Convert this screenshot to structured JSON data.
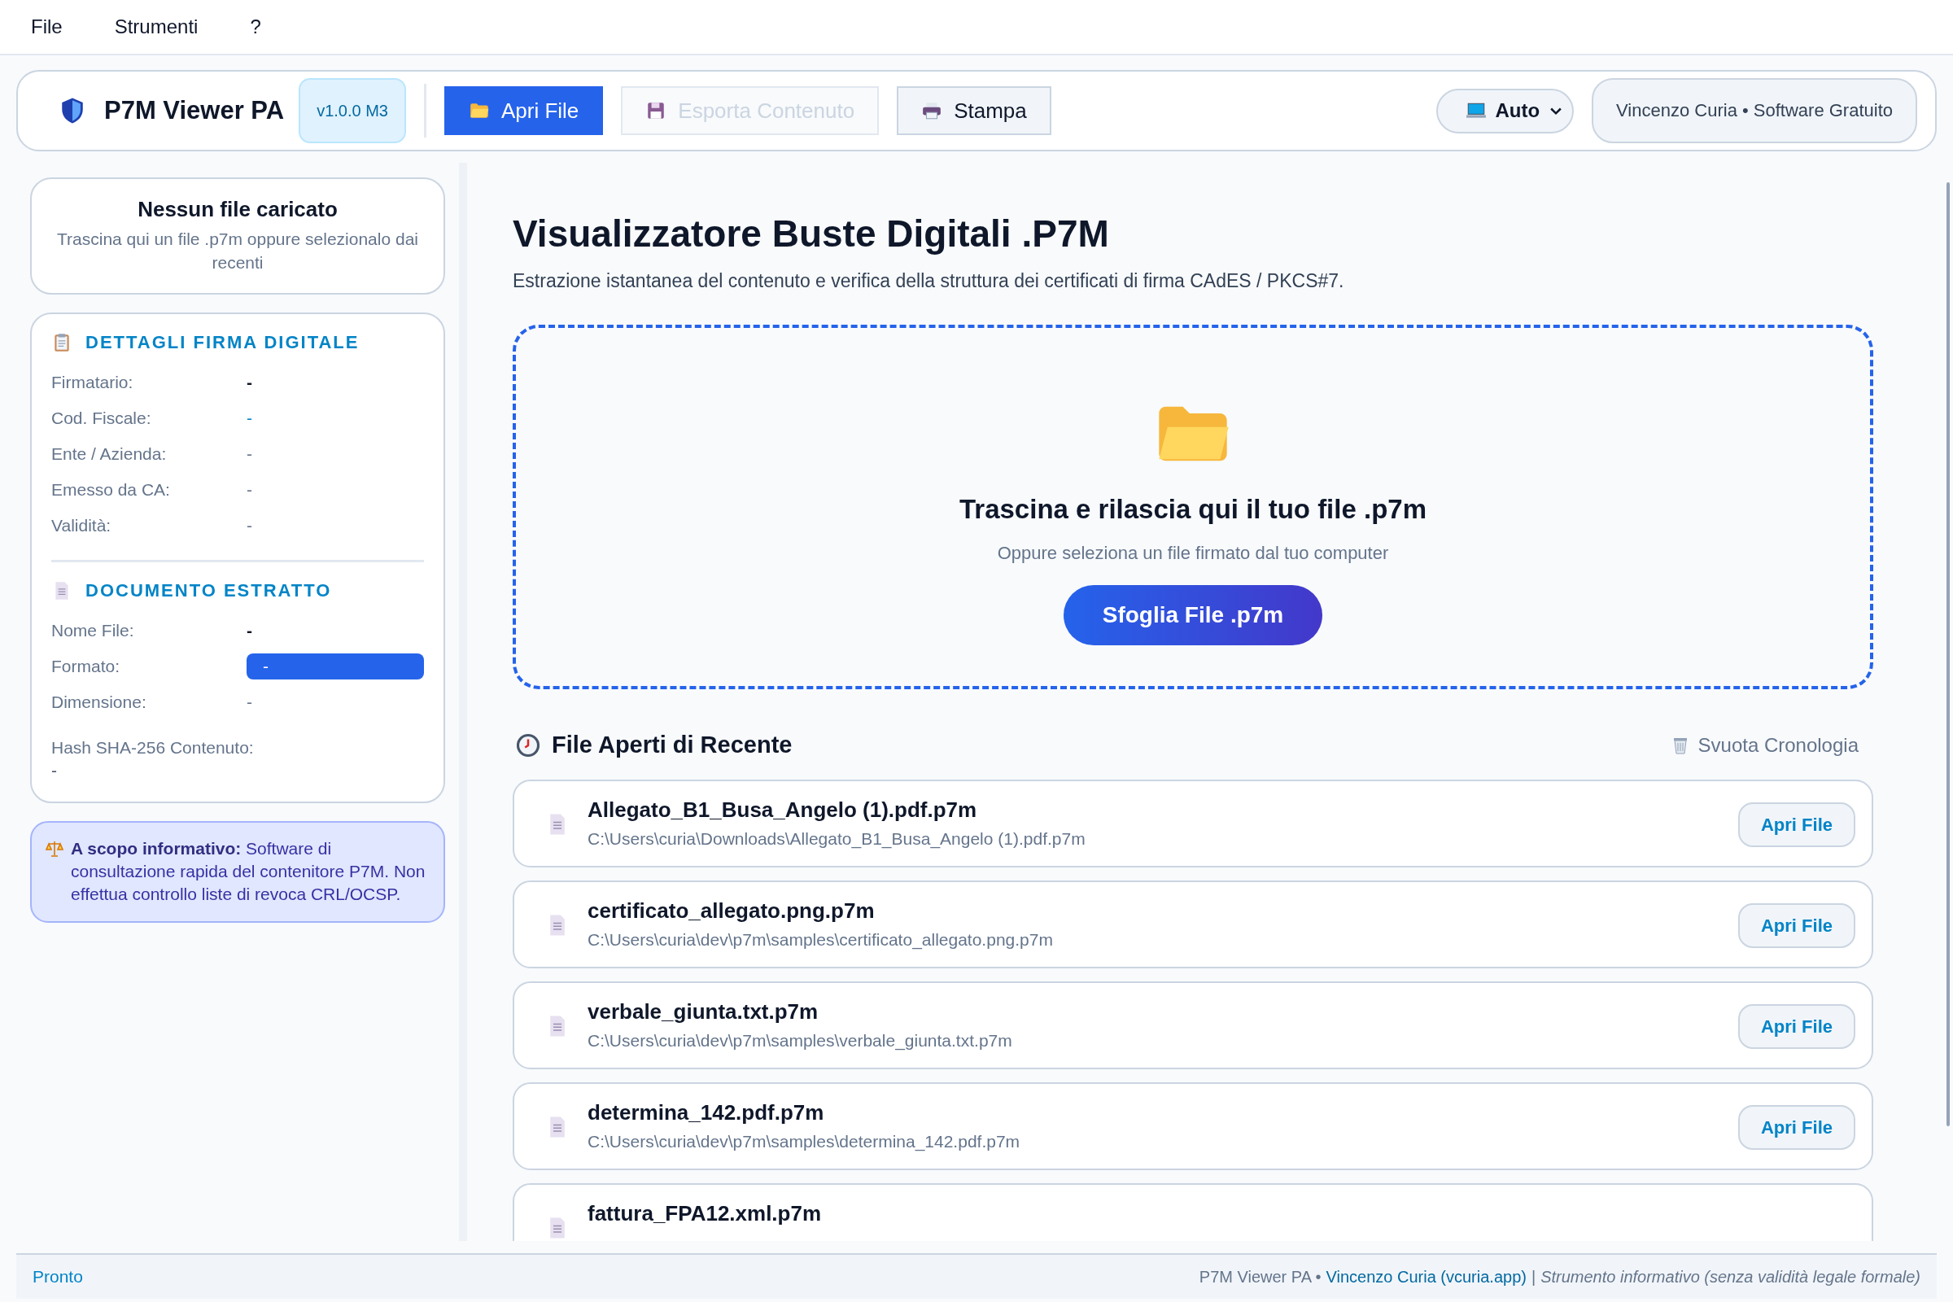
{
  "menu": [
    {
      "label": "File"
    },
    {
      "label": "Strumenti"
    },
    {
      "label": "?"
    }
  ],
  "toolbar": {
    "app_name": "P7M Viewer PA",
    "version": "v1.0.0 M3",
    "buttons": [
      {
        "label": "Apri File",
        "kind": "primary",
        "disabled": false
      },
      {
        "label": "Esporta Contenuto",
        "kind": "secondary",
        "disabled": true
      },
      {
        "label": "Stampa",
        "kind": "secondary",
        "disabled": false
      }
    ],
    "theme": {
      "label": "Auto"
    },
    "credit": "Vincenzo Curia • Software Gratuito"
  },
  "sidebar": {
    "status": {
      "title": "Nessun file caricato",
      "hint": "Trascina qui un file .p7m oppure selezionalo dai recenti"
    },
    "sections": [
      {
        "title": "DETTAGLI FIRMA DIGITALE",
        "fields": [
          {
            "label": "Firmatario:",
            "value": "-",
            "kind": "strong"
          },
          {
            "label": "Cod. Fiscale:",
            "value": "-",
            "kind": "code"
          },
          {
            "label": "Ente / Azienda:",
            "value": "-",
            "kind": "plain"
          },
          {
            "label": "Emesso da CA:",
            "value": "-",
            "kind": "plain"
          },
          {
            "label": "Validità:",
            "value": "-",
            "kind": "plain"
          }
        ]
      },
      {
        "title": "DOCUMENTO ESTRATTO",
        "fields": [
          {
            "label": "Nome File:",
            "value": "-",
            "kind": "strong"
          },
          {
            "label": "Formato:",
            "value": "-",
            "kind": "badge"
          },
          {
            "label": "Dimensione:",
            "value": "-",
            "kind": "plain"
          },
          {
            "label": "Hash SHA-256 Contenuto:",
            "value": "-",
            "kind": "block"
          }
        ]
      }
    ],
    "notice": "**A scopo informativo:** Software di consultazione rapida del contenitore P7M. Non effettua controllo liste di revoca CRL/OCSP."
  },
  "main": {
    "title": "Visualizzatore Buste Digitali .P7M",
    "subtitle": "Estrazione istantanea del contenuto e verifica della struttura dei certificati di firma CAdES / PKCS#7.",
    "dropzone": {
      "title": "Trascina e rilascia qui il tuo file .p7m",
      "hint": "Oppure seleziona un file firmato dal tuo computer",
      "button": "Sfoglia File .p7m"
    },
    "recent": {
      "title": "File Aperti di Recente",
      "clear_label": "Svuota Cronologia",
      "items": [
        {
          "name": "Allegato_B1_Busa_Angelo (1).pdf.p7m",
          "path": "C:\\Users\\curia\\Downloads\\Allegato_B1_Busa_Angelo (1).pdf.p7m",
          "button": "Apri File"
        },
        {
          "name": "certificato_allegato.png.p7m",
          "path": "C:\\Users\\curia\\dev\\p7m\\samples\\certificato_allegato.png.p7m",
          "button": "Apri File"
        },
        {
          "name": "verbale_giunta.txt.p7m",
          "path": "C:\\Users\\curia\\dev\\p7m\\samples\\verbale_giunta.txt.p7m",
          "button": "Apri File"
        },
        {
          "name": "determina_142.pdf.p7m",
          "path": "C:\\Users\\curia\\dev\\p7m\\samples\\determina_142.pdf.p7m",
          "button": "Apri File"
        },
        {
          "name": "fattura_FPA12.xml.p7m"
        }
      ]
    }
  },
  "status_bar": {
    "status": "Pronto",
    "app": "P7M Viewer PA •",
    "link": "Vincenzo Curia (vcuria.app)",
    "separator": "|",
    "note": "Strumento informativo (senza validità legale formale)"
  }
}
